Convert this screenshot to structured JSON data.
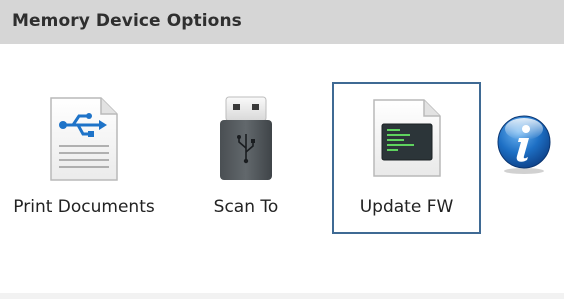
{
  "header": {
    "title": "Memory Device Options"
  },
  "options": [
    {
      "label": "Print Documents",
      "icon": "usb-document-icon",
      "selected": false
    },
    {
      "label": "Scan To",
      "icon": "usb-drive-icon",
      "selected": false
    },
    {
      "label": "Update FW",
      "icon": "firmware-update-icon",
      "selected": true
    }
  ],
  "info": {
    "icon": "info-icon"
  },
  "colors": {
    "title_bar": "#d6d6d6",
    "selection_border": "#3f6a94",
    "info_blue": "#1d6fc4"
  }
}
